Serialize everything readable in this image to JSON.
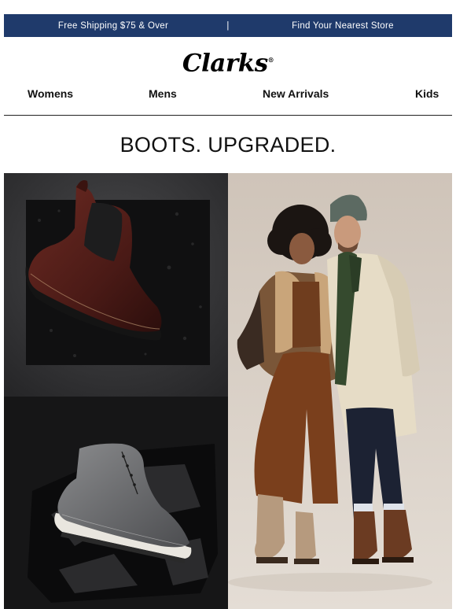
{
  "top_bar": {
    "shipping_text": "Free Shipping $75 & Over",
    "separator": "|",
    "store_text": "Find Your Nearest Store",
    "background_color": "#1f3a6b"
  },
  "brand": {
    "logo_text": "Clarks",
    "registered_mark": "®"
  },
  "nav": {
    "items": [
      {
        "label": "Womens"
      },
      {
        "label": "Mens"
      },
      {
        "label": "New Arrivals"
      },
      {
        "label": "Kids"
      }
    ]
  },
  "headline": "BOOTS. UPGRADED.",
  "hero": {
    "tiles": [
      {
        "subject": "burgundy-chelsea-boot"
      },
      {
        "subject": "grey-chukka-boot"
      },
      {
        "subject": "couple-in-boots"
      }
    ]
  }
}
